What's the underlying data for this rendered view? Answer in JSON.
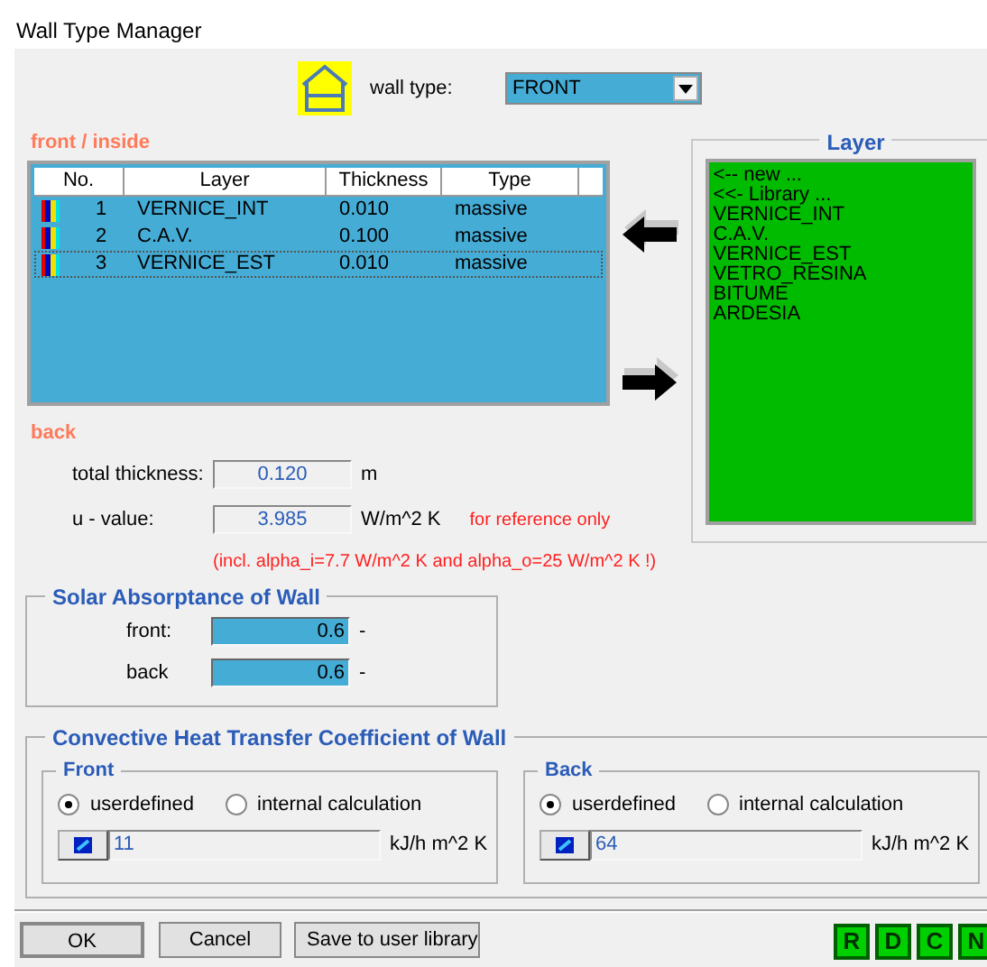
{
  "window": {
    "title": "Wall Type Manager"
  },
  "wall_type": {
    "label": "wall type:",
    "value": "FRONT"
  },
  "front_label": "front / inside",
  "table": {
    "columns": [
      "No.",
      "Layer",
      "Thickness",
      "Type"
    ],
    "rows": [
      {
        "no": "1",
        "layer": "VERNICE_INT",
        "thickness": "0.010",
        "type": "massive",
        "focused": false
      },
      {
        "no": "2",
        "layer": "C.A.V.",
        "thickness": "0.100",
        "type": "massive",
        "focused": false
      },
      {
        "no": "3",
        "layer": "VERNICE_EST",
        "thickness": "0.010",
        "type": "massive",
        "focused": true
      }
    ]
  },
  "layer_panel": {
    "title": "Layer",
    "items": [
      "<-- new ...",
      "<<- Library ...",
      "VERNICE_INT",
      "C.A.V.",
      "VERNICE_EST",
      "VETRO_RESINA",
      "BITUME",
      "ARDESIA"
    ]
  },
  "back_label": "back",
  "total_thickness": {
    "label": "total thickness:",
    "value": "0.120",
    "unit": "m"
  },
  "u_value": {
    "label": "u - value:",
    "value": "3.985",
    "unit": "W/m^2 K",
    "note": "for reference only",
    "detail": "(incl. alpha_i=7.7 W/m^2 K and alpha_o=25 W/m^2 K !)"
  },
  "solar": {
    "title": "Solar Absorptance of Wall",
    "rows": [
      {
        "label": "front:",
        "value": "0.6",
        "unit": "-"
      },
      {
        "label": "back",
        "value": "0.6",
        "unit": "-"
      }
    ]
  },
  "convective": {
    "title": "Convective Heat Transfer Coefficient of Wall",
    "groups": [
      {
        "title": "Front",
        "options": [
          {
            "label": "userdefined",
            "selected": true
          },
          {
            "label": "internal calculation",
            "selected": false
          }
        ],
        "value": "11",
        "unit": "kJ/h m^2 K"
      },
      {
        "title": "Back",
        "options": [
          {
            "label": "userdefined",
            "selected": true
          },
          {
            "label": "internal calculation",
            "selected": false
          }
        ],
        "value": "64",
        "unit": "kJ/h m^2 K"
      }
    ]
  },
  "buttons": [
    "OK",
    "Cancel",
    "Save to user library"
  ],
  "quick_buttons": [
    "R",
    "D",
    "C",
    "N"
  ]
}
